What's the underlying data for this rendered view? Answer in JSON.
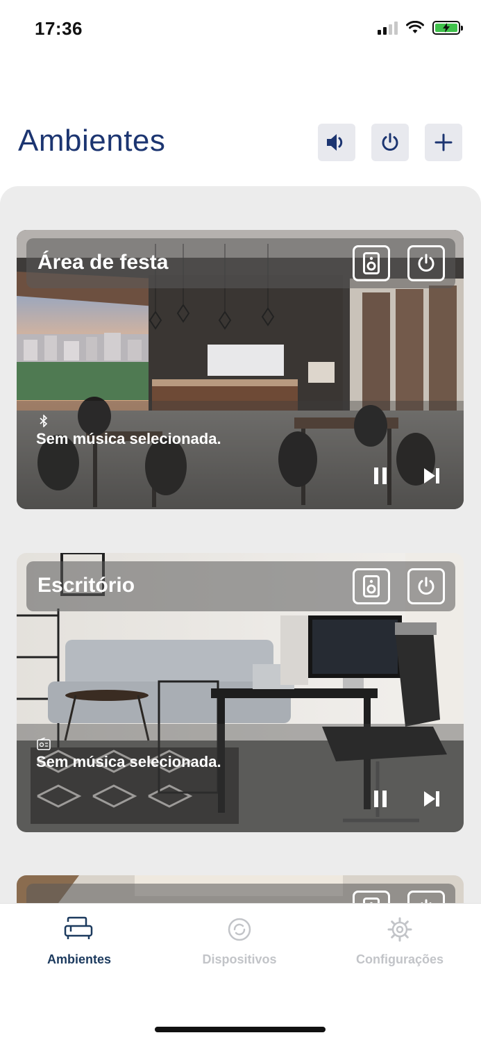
{
  "status_bar": {
    "time": "17:36"
  },
  "header": {
    "title": "Ambientes"
  },
  "rooms": [
    {
      "name": "Área de festa",
      "now_playing": "Sem música selecionada."
    },
    {
      "name": "Escritório",
      "now_playing": "Sem música selecionada."
    },
    {
      "name": ""
    }
  ],
  "tabbar": {
    "tabs": [
      {
        "label": "Ambientes",
        "icon": "sofa-icon",
        "active": true
      },
      {
        "label": "Dispositivos",
        "icon": "device-icon",
        "active": false
      },
      {
        "label": "Configurações",
        "icon": "gear-icon",
        "active": false
      }
    ]
  },
  "colors": {
    "accent": "#1c3571",
    "tab_active": "#1c3a5e",
    "tab_inactive": "#c2c4c8",
    "panel_bg": "#ececec",
    "battery": "#3fc14b"
  }
}
